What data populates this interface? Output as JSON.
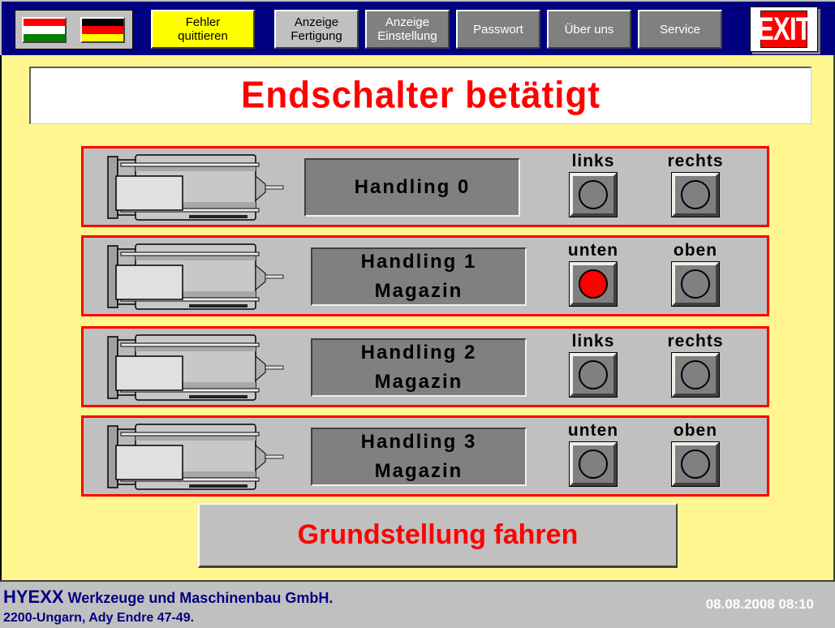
{
  "toolbar": {
    "languages": [
      {
        "name": "hungarian",
        "colors": [
          "#ff0000",
          "#ffffff",
          "#008000"
        ]
      },
      {
        "name": "german",
        "colors": [
          "#000000",
          "#ff0000",
          "#ffff00"
        ]
      }
    ],
    "buttons": [
      {
        "label": "Fehler\nquittieren",
        "style": "yellow"
      },
      {
        "label": "Anzeige\nFertigung",
        "style": "light"
      },
      {
        "label": "Anzeige\nEinstellung",
        "style": "dark"
      },
      {
        "label": "Passwort",
        "style": "dark"
      },
      {
        "label": "Über uns",
        "style": "dark"
      },
      {
        "label": "Service",
        "style": "dark"
      }
    ],
    "exit_label": "EXIT"
  },
  "banner": {
    "message": "Endschalter betätigt",
    "color": "#ff0000"
  },
  "handlings": [
    {
      "line1": "Handling 0",
      "line2": "",
      "switches": [
        {
          "label": "links",
          "active": false
        },
        {
          "label": "rechts",
          "active": false
        }
      ]
    },
    {
      "line1": "Handling 1",
      "line2": "Magazin",
      "switches": [
        {
          "label": "unten",
          "active": true
        },
        {
          "label": "oben",
          "active": false
        }
      ]
    },
    {
      "line1": "Handling 2",
      "line2": "Magazin",
      "switches": [
        {
          "label": "links",
          "active": false
        },
        {
          "label": "rechts",
          "active": false
        }
      ]
    },
    {
      "line1": "Handling 3",
      "line2": "Magazin",
      "switches": [
        {
          "label": "unten",
          "active": false
        },
        {
          "label": "oben",
          "active": false
        }
      ]
    }
  ],
  "home_button": "Grundstellung fahren",
  "footer": {
    "brand": "HYEXX",
    "company": "Werkzeuge und Maschinenbau GmbH.",
    "address": "2200-Ungarn, Ady Endre 47-49.",
    "datetime": "08.08.2008 08:10"
  },
  "colors": {
    "header_bg": "#000080",
    "main_bg": "#fff68f",
    "panel_border": "#ff0000",
    "lamp_active": "#ff0000"
  }
}
